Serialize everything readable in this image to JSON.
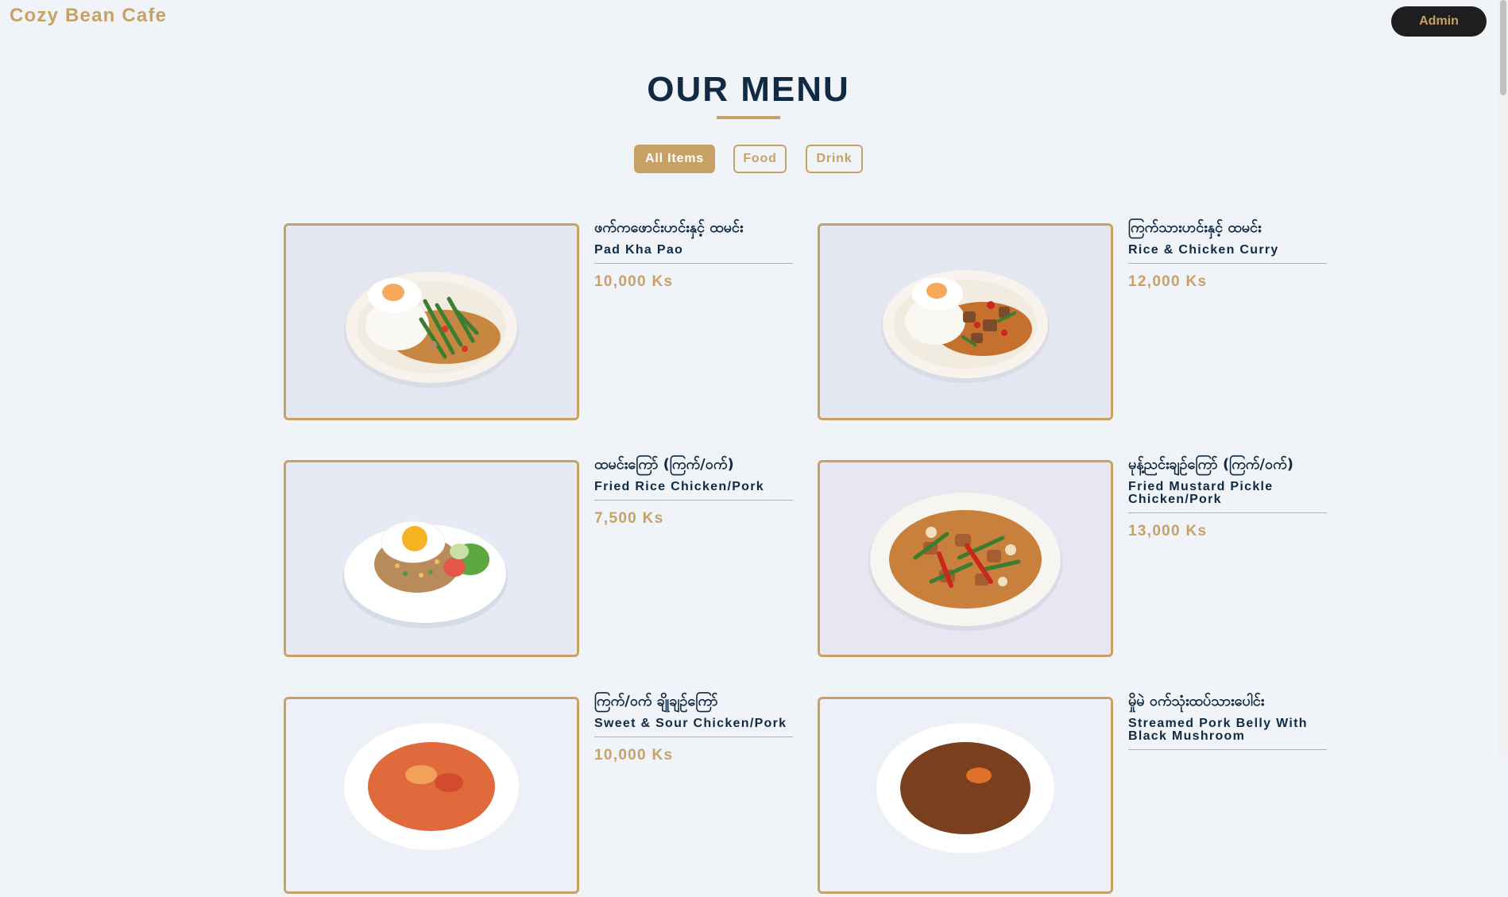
{
  "header": {
    "brand": "Cozy Bean Cafe",
    "admin_label": "Admin"
  },
  "menu": {
    "title": "OUR MENU"
  },
  "filters": [
    "All Items",
    "Food",
    "Drink"
  ],
  "active_filter": "All Items",
  "items": [
    {
      "name_mm": "ဖက်ကဖောင်းဟင်းနှင့် ထမင်း",
      "name_en": "Pad Kha Pao",
      "price": "10,000 Ks"
    },
    {
      "name_mm": "ကြက်သားဟင်းနှင့် ထမင်း",
      "name_en": "Rice & Chicken Curry",
      "price": "12,000 Ks"
    },
    {
      "name_mm": "ထမင်းကြော် (ကြက်/ဝက်)",
      "name_en": "Fried Rice Chicken/Pork",
      "price": "7,500 Ks"
    },
    {
      "name_mm": "မုန့်ညင်းချဉ်ကြော် (ကြက်/ဝက်)",
      "name_en": "Fried Mustard Pickle Chicken/Pork",
      "price": "13,000 Ks"
    },
    {
      "name_mm": "ကြက်/ဝက် ချိုချဉ်ကြော်",
      "name_en": "Sweet & Sour Chicken/Pork",
      "price": "10,000 Ks"
    },
    {
      "name_mm": "မှိုမဲ ဝက်သုံးထပ်သားပေါင်း",
      "name_en": "Streamed Pork Belly With Black Mushroom",
      "price": ""
    }
  ],
  "colors": {
    "accent": "#c8a165",
    "navy": "#102a43",
    "background": "#f0f4f8",
    "admin_bg": "#1e1e1e"
  }
}
